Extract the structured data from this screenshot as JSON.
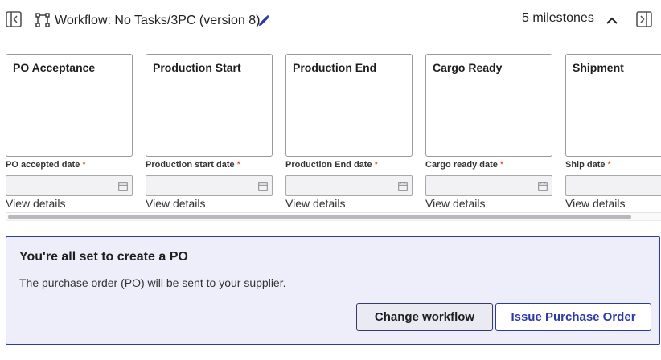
{
  "header": {
    "title": "Workflow:  No Tasks/3PC (version 8)",
    "milestone_count": "5 milestones"
  },
  "milestones": [
    {
      "name": "PO Acceptance",
      "date_label": "PO accepted date",
      "required": "*",
      "link": "View details"
    },
    {
      "name": "Production Start",
      "date_label": "Production start date",
      "required": "*",
      "link": "View details"
    },
    {
      "name": "Production End",
      "date_label": "Production End date",
      "required": "*",
      "link": "View details"
    },
    {
      "name": "Cargo Ready",
      "date_label": "Cargo ready date",
      "required": "*",
      "link": "View details"
    },
    {
      "name": "Shipment",
      "date_label": "Ship date",
      "required": "*",
      "link": "View details"
    }
  ],
  "banner": {
    "title": "You're all set to create a PO",
    "text": "The purchase order (PO) will be sent to your supplier.",
    "change_label": "Change workflow",
    "issue_label": "Issue Purchase Order"
  },
  "colors": {
    "accent": "#2c3aa8",
    "required": "#d4351c",
    "banner_bg": "#eeeefa"
  },
  "icons": [
    "panel-left-icon",
    "workflow-icon",
    "pencil-edit-icon",
    "chevron-up-icon",
    "panel-right-icon",
    "calendar-icon"
  ]
}
